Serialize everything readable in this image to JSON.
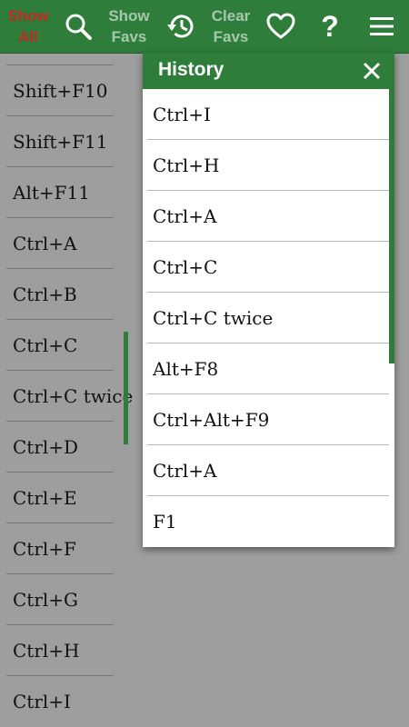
{
  "toolbar": {
    "show_all": "Show\nAll",
    "show_favs": "Show\nFavs",
    "clear_favs": "Clear\nFavs",
    "icons": [
      "search-icon",
      "history-icon",
      "heart-icon",
      "help-icon",
      "menu-icon"
    ],
    "accent": "#2e7d3a",
    "active_color": "#c62828"
  },
  "shortcut_list": {
    "items": [
      "Shift+F10",
      "Shift+F11",
      "Alt+F11",
      "Ctrl+A",
      "Ctrl+B",
      "Ctrl+C",
      "Ctrl+C twice",
      "Ctrl+D",
      "Ctrl+E",
      "Ctrl+F",
      "Ctrl+G",
      "Ctrl+H",
      "Ctrl+I"
    ]
  },
  "history_dialog": {
    "title": "History",
    "items": [
      "Ctrl+I",
      "Ctrl+H",
      "Ctrl+A",
      "Ctrl+C",
      "Ctrl+C twice",
      "Alt+F8",
      "Ctrl+Alt+F9",
      "Ctrl+A",
      "F1"
    ]
  }
}
